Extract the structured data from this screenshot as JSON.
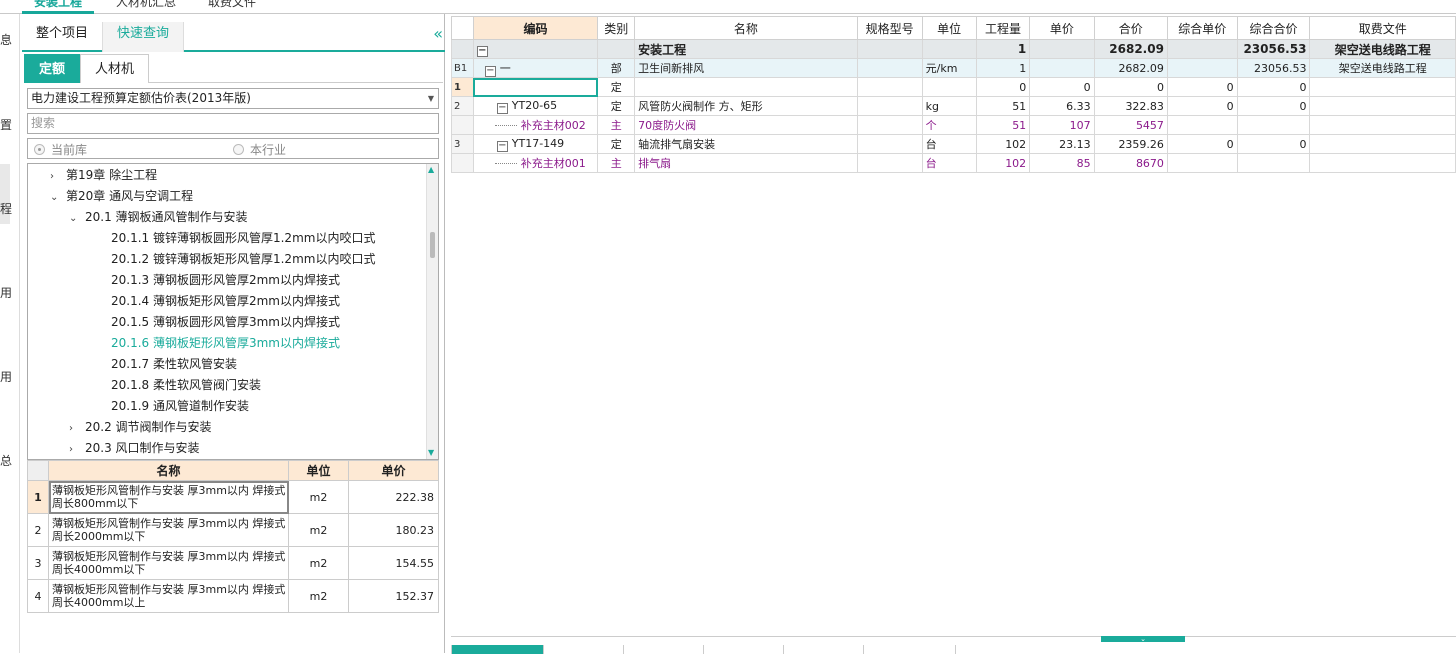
{
  "top_tabs": [
    "安装工程",
    "人材机汇总",
    "取费文件"
  ],
  "left_strip": [
    "息",
    "置",
    "程",
    "用",
    "用",
    "总"
  ],
  "left_panel": {
    "tabs": [
      "整个项目",
      "快速查询"
    ],
    "collapse_icon": "«",
    "sub_tabs": [
      "定额",
      "人材机"
    ],
    "quota_library": "电力建设工程预算定额估价表(2013年版)",
    "search_placeholder": "搜索",
    "radio_current": "当前库",
    "radio_industry": "本行业",
    "tree": [
      {
        "label": "第19章  除尘工程",
        "chev": "›"
      },
      {
        "label": "第20章  通风与空调工程",
        "chev": "⌄"
      },
      {
        "label": "20.1  薄钢板通风管制作与安装",
        "chev": "⌄"
      },
      {
        "label": "20.1.1  镀锌薄钢板圆形风管厚1.2mm以内咬口式",
        "chev": ""
      },
      {
        "label": "20.1.2  镀锌薄钢板矩形风管厚1.2mm以内咬口式",
        "chev": ""
      },
      {
        "label": "20.1.3  薄钢板圆形风管厚2mm以内焊接式",
        "chev": ""
      },
      {
        "label": "20.1.4  薄钢板矩形风管厚2mm以内焊接式",
        "chev": ""
      },
      {
        "label": "20.1.5  薄钢板圆形风管厚3mm以内焊接式",
        "chev": ""
      },
      {
        "label": "20.1.6  薄钢板矩形风管厚3mm以内焊接式",
        "chev": ""
      },
      {
        "label": "20.1.7  柔性软风管安装",
        "chev": ""
      },
      {
        "label": "20.1.8  柔性软风管阀门安装",
        "chev": ""
      },
      {
        "label": "20.1.9  通风管道制作安装",
        "chev": ""
      },
      {
        "label": "20.2  调节阀制作与安装",
        "chev": "›"
      },
      {
        "label": "20.3  风口制作与安装",
        "chev": "›"
      }
    ],
    "result_headers": {
      "name": "名称",
      "unit": "单位",
      "price": "单价"
    },
    "results": [
      {
        "idx": "1",
        "name": "薄钢板矩形风管制作与安装 厚3mm以内 焊接式 周长800mm以下",
        "unit": "m2",
        "price": "222.38"
      },
      {
        "idx": "2",
        "name": "薄钢板矩形风管制作与安装 厚3mm以内 焊接式 周长2000mm以下",
        "unit": "m2",
        "price": "180.23"
      },
      {
        "idx": "3",
        "name": "薄钢板矩形风管制作与安装 厚3mm以内 焊接式 周长4000mm以下",
        "unit": "m2",
        "price": "154.55"
      },
      {
        "idx": "4",
        "name": "薄钢板矩形风管制作与安装 厚3mm以内 焊接式 周长4000mm以上",
        "unit": "m2",
        "price": "152.37"
      }
    ]
  },
  "grid": {
    "headers": [
      "编码",
      "类别",
      "名称",
      "规格型号",
      "单位",
      "工程量",
      "单价",
      "合价",
      "综合单价",
      "综合合价",
      "取费文件"
    ],
    "rows": [
      {
        "rn": "",
        "box": "−",
        "indent": 0,
        "code": "",
        "type": "",
        "name": "安装工程",
        "spec": "",
        "unit": "",
        "qty": "1",
        "price": "",
        "total": "2682.09",
        "cunit": "",
        "ctotal": "23056.53",
        "fee": "架空送电线路工程",
        "kind": "sec"
      },
      {
        "rn": "B1",
        "box": "−",
        "indent": 8,
        "code": "一",
        "type": "部",
        "name": "卫生间新排风",
        "spec": "",
        "unit": "元/km",
        "qty": "1",
        "price": "",
        "total": "2682.09",
        "cunit": "",
        "ctotal": "23056.53",
        "fee": "架空送电线路工程",
        "kind": "bu"
      },
      {
        "rn": "1",
        "box": "",
        "indent": 0,
        "code": "",
        "type": "定",
        "name": "",
        "spec": "",
        "unit": "",
        "qty": "0",
        "price": "0",
        "total": "0",
        "cunit": "0",
        "ctotal": "0",
        "fee": "",
        "kind": "sel"
      },
      {
        "rn": "2",
        "box": "−",
        "indent": 20,
        "code": "YT20-65",
        "type": "定",
        "name": "风管防火阀制作 方、矩形",
        "spec": "",
        "unit": "kg",
        "qty": "51",
        "price": "6.33",
        "total": "322.83",
        "cunit": "0",
        "ctotal": "0",
        "fee": "",
        "kind": ""
      },
      {
        "rn": "",
        "box": "",
        "indent": 44,
        "code": "补充主材002",
        "type": "主",
        "name": "70度防火阀",
        "spec": "",
        "unit": "个",
        "qty": "51",
        "price": "107",
        "total": "5457",
        "cunit": "",
        "ctotal": "",
        "fee": "",
        "kind": "mat"
      },
      {
        "rn": "3",
        "box": "−",
        "indent": 20,
        "code": "YT17-149",
        "type": "定",
        "name": "轴流排气扇安装",
        "spec": "",
        "unit": "台",
        "qty": "102",
        "price": "23.13",
        "total": "2359.26",
        "cunit": "0",
        "ctotal": "0",
        "fee": "",
        "kind": ""
      },
      {
        "rn": "",
        "box": "",
        "indent": 44,
        "code": "补充主材001",
        "type": "主",
        "name": "排气扇",
        "spec": "",
        "unit": "台",
        "qty": "102",
        "price": "85",
        "total": "8670",
        "cunit": "",
        "ctotal": "",
        "fee": "",
        "kind": "mat"
      }
    ]
  },
  "colors": {
    "accent": "#1aab9b",
    "header_highlight": "#fde9d4",
    "material_text": "#8b1a8b"
  }
}
